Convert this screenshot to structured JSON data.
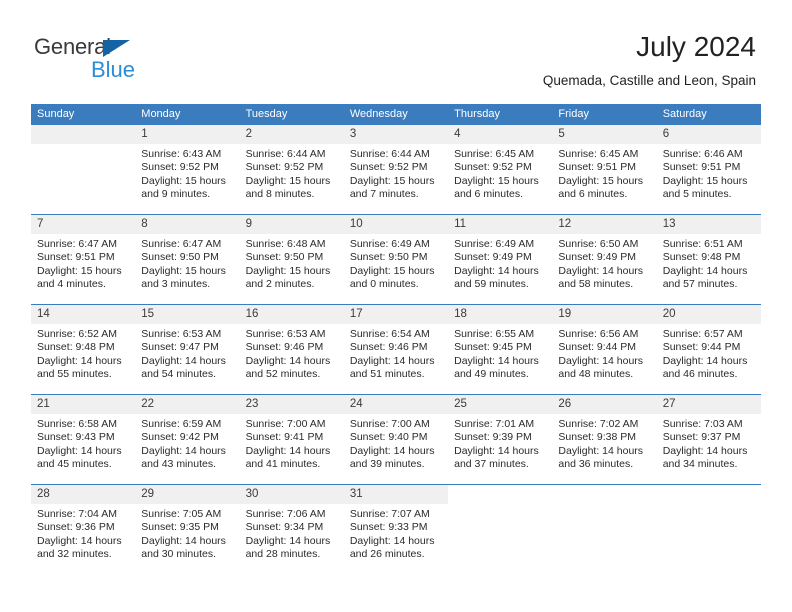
{
  "brand": {
    "line1": "General",
    "line2": "Blue",
    "mark": "triangle-logo"
  },
  "header": {
    "title": "July 2024",
    "subtitle": "Quemada, Castille and Leon, Spain"
  },
  "colors": {
    "header_blue": "#3a7cbe",
    "daynum_band": "#f0f0f0",
    "brand_blue": "#2c8ed6",
    "logo_blue": "#1464a5",
    "text": "#222222"
  },
  "weekday_headers": [
    "Sunday",
    "Monday",
    "Tuesday",
    "Wednesday",
    "Thursday",
    "Friday",
    "Saturday"
  ],
  "weeks": [
    [
      {
        "day": "",
        "lines": []
      },
      {
        "day": "1",
        "lines": [
          "Sunrise: 6:43 AM",
          "Sunset: 9:52 PM",
          "Daylight: 15 hours",
          "and 9 minutes."
        ]
      },
      {
        "day": "2",
        "lines": [
          "Sunrise: 6:44 AM",
          "Sunset: 9:52 PM",
          "Daylight: 15 hours",
          "and 8 minutes."
        ]
      },
      {
        "day": "3",
        "lines": [
          "Sunrise: 6:44 AM",
          "Sunset: 9:52 PM",
          "Daylight: 15 hours",
          "and 7 minutes."
        ]
      },
      {
        "day": "4",
        "lines": [
          "Sunrise: 6:45 AM",
          "Sunset: 9:52 PM",
          "Daylight: 15 hours",
          "and 6 minutes."
        ]
      },
      {
        "day": "5",
        "lines": [
          "Sunrise: 6:45 AM",
          "Sunset: 9:51 PM",
          "Daylight: 15 hours",
          "and 6 minutes."
        ]
      },
      {
        "day": "6",
        "lines": [
          "Sunrise: 6:46 AM",
          "Sunset: 9:51 PM",
          "Daylight: 15 hours",
          "and 5 minutes."
        ]
      }
    ],
    [
      {
        "day": "7",
        "lines": [
          "Sunrise: 6:47 AM",
          "Sunset: 9:51 PM",
          "Daylight: 15 hours",
          "and 4 minutes."
        ]
      },
      {
        "day": "8",
        "lines": [
          "Sunrise: 6:47 AM",
          "Sunset: 9:50 PM",
          "Daylight: 15 hours",
          "and 3 minutes."
        ]
      },
      {
        "day": "9",
        "lines": [
          "Sunrise: 6:48 AM",
          "Sunset: 9:50 PM",
          "Daylight: 15 hours",
          "and 2 minutes."
        ]
      },
      {
        "day": "10",
        "lines": [
          "Sunrise: 6:49 AM",
          "Sunset: 9:50 PM",
          "Daylight: 15 hours",
          "and 0 minutes."
        ]
      },
      {
        "day": "11",
        "lines": [
          "Sunrise: 6:49 AM",
          "Sunset: 9:49 PM",
          "Daylight: 14 hours",
          "and 59 minutes."
        ]
      },
      {
        "day": "12",
        "lines": [
          "Sunrise: 6:50 AM",
          "Sunset: 9:49 PM",
          "Daylight: 14 hours",
          "and 58 minutes."
        ]
      },
      {
        "day": "13",
        "lines": [
          "Sunrise: 6:51 AM",
          "Sunset: 9:48 PM",
          "Daylight: 14 hours",
          "and 57 minutes."
        ]
      }
    ],
    [
      {
        "day": "14",
        "lines": [
          "Sunrise: 6:52 AM",
          "Sunset: 9:48 PM",
          "Daylight: 14 hours",
          "and 55 minutes."
        ]
      },
      {
        "day": "15",
        "lines": [
          "Sunrise: 6:53 AM",
          "Sunset: 9:47 PM",
          "Daylight: 14 hours",
          "and 54 minutes."
        ]
      },
      {
        "day": "16",
        "lines": [
          "Sunrise: 6:53 AM",
          "Sunset: 9:46 PM",
          "Daylight: 14 hours",
          "and 52 minutes."
        ]
      },
      {
        "day": "17",
        "lines": [
          "Sunrise: 6:54 AM",
          "Sunset: 9:46 PM",
          "Daylight: 14 hours",
          "and 51 minutes."
        ]
      },
      {
        "day": "18",
        "lines": [
          "Sunrise: 6:55 AM",
          "Sunset: 9:45 PM",
          "Daylight: 14 hours",
          "and 49 minutes."
        ]
      },
      {
        "day": "19",
        "lines": [
          "Sunrise: 6:56 AM",
          "Sunset: 9:44 PM",
          "Daylight: 14 hours",
          "and 48 minutes."
        ]
      },
      {
        "day": "20",
        "lines": [
          "Sunrise: 6:57 AM",
          "Sunset: 9:44 PM",
          "Daylight: 14 hours",
          "and 46 minutes."
        ]
      }
    ],
    [
      {
        "day": "21",
        "lines": [
          "Sunrise: 6:58 AM",
          "Sunset: 9:43 PM",
          "Daylight: 14 hours",
          "and 45 minutes."
        ]
      },
      {
        "day": "22",
        "lines": [
          "Sunrise: 6:59 AM",
          "Sunset: 9:42 PM",
          "Daylight: 14 hours",
          "and 43 minutes."
        ]
      },
      {
        "day": "23",
        "lines": [
          "Sunrise: 7:00 AM",
          "Sunset: 9:41 PM",
          "Daylight: 14 hours",
          "and 41 minutes."
        ]
      },
      {
        "day": "24",
        "lines": [
          "Sunrise: 7:00 AM",
          "Sunset: 9:40 PM",
          "Daylight: 14 hours",
          "and 39 minutes."
        ]
      },
      {
        "day": "25",
        "lines": [
          "Sunrise: 7:01 AM",
          "Sunset: 9:39 PM",
          "Daylight: 14 hours",
          "and 37 minutes."
        ]
      },
      {
        "day": "26",
        "lines": [
          "Sunrise: 7:02 AM",
          "Sunset: 9:38 PM",
          "Daylight: 14 hours",
          "and 36 minutes."
        ]
      },
      {
        "day": "27",
        "lines": [
          "Sunrise: 7:03 AM",
          "Sunset: 9:37 PM",
          "Daylight: 14 hours",
          "and 34 minutes."
        ]
      }
    ],
    [
      {
        "day": "28",
        "lines": [
          "Sunrise: 7:04 AM",
          "Sunset: 9:36 PM",
          "Daylight: 14 hours",
          "and 32 minutes."
        ]
      },
      {
        "day": "29",
        "lines": [
          "Sunrise: 7:05 AM",
          "Sunset: 9:35 PM",
          "Daylight: 14 hours",
          "and 30 minutes."
        ]
      },
      {
        "day": "30",
        "lines": [
          "Sunrise: 7:06 AM",
          "Sunset: 9:34 PM",
          "Daylight: 14 hours",
          "and 28 minutes."
        ]
      },
      {
        "day": "31",
        "lines": [
          "Sunrise: 7:07 AM",
          "Sunset: 9:33 PM",
          "Daylight: 14 hours",
          "and 26 minutes."
        ]
      },
      {
        "day": "",
        "lines": []
      },
      {
        "day": "",
        "lines": []
      },
      {
        "day": "",
        "lines": []
      }
    ]
  ]
}
